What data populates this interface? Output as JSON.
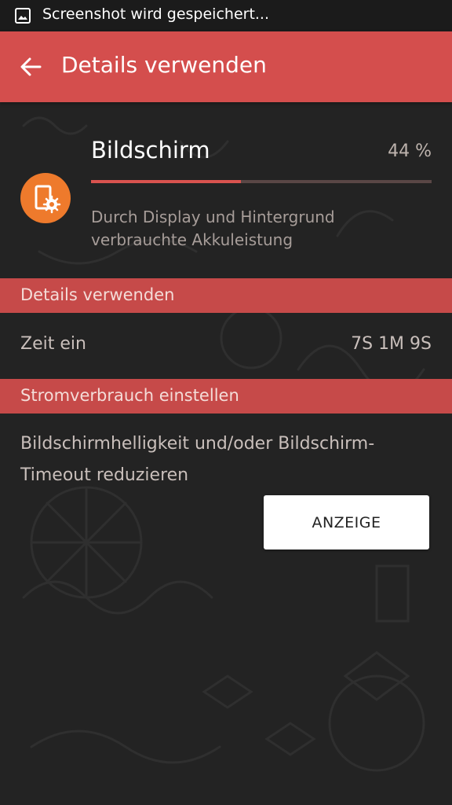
{
  "status_bar": {
    "notification_icon": "screenshot-image-icon",
    "text": "Screenshot wird gespeichert..."
  },
  "app_bar": {
    "back_icon": "arrow-left-icon",
    "title": "Details verwenden",
    "color": "#d44e4d"
  },
  "item": {
    "icon": "screen-settings-icon",
    "icon_color": "#ee7a2c",
    "title": "Bildschirm",
    "percent_label": "44 %",
    "progress_fraction": 0.44,
    "description": "Durch Display und Hintergrund verbrauchte Akkuleistung"
  },
  "details_section": {
    "header": "Details verwenden",
    "rows": [
      {
        "label": "Zeit ein",
        "value": "7S 1M 9S"
      }
    ]
  },
  "power_section": {
    "header": "Stromverbrauch einstellen",
    "tip": "Bildschirmhelligkeit und/oder Bildschirm-Timeout reduzieren",
    "button_label": "ANZEIGE"
  }
}
